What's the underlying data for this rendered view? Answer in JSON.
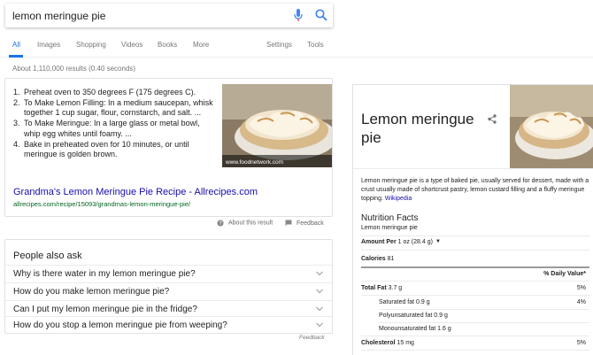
{
  "search": {
    "query": "lemon meringue pie",
    "mic_icon": "mic-icon",
    "search_icon": "search-icon",
    "colors": {
      "mic_blue": "#4285f4",
      "mic_red": "#ea4335",
      "search_blue": "#4285f4"
    }
  },
  "tabs": {
    "all": "All",
    "images": "Images",
    "shopping": "Shopping",
    "videos": "Videos",
    "books": "Books",
    "more": "More",
    "settings": "Settings",
    "tools": "Tools",
    "active": "All",
    "accent": "#1a73e8"
  },
  "result_stats": "About 1,110,000 results (0.40 seconds)",
  "snippet": {
    "steps": [
      {
        "num": "1.",
        "text": "Preheat oven to 350 degrees F (175 degrees C)."
      },
      {
        "num": "2.",
        "text": "To Make Lemon Filling: In a medium saucepan, whisk together 1 cup sugar, flour, cornstarch, and salt. ..."
      },
      {
        "num": "3.",
        "text": "To Make Meringue: In a large glass or metal bowl, whip egg whites until foamy. ..."
      },
      {
        "num": "4.",
        "text": "Bake in preheated oven for 10 minutes, or until meringue is golden brown."
      }
    ],
    "image_credit": "www.foodnetwork.com",
    "link_title": "Grandma's Lemon Meringue Pie Recipe - Allrecipes.com",
    "url": "allrecipes.com/recipe/15093/grandmas-lemon-meringue-pie/",
    "link_color": "#1a0dab",
    "url_color": "#006621"
  },
  "about_result": "About this result",
  "feedback": "Feedback",
  "people_also_ask": {
    "title": "People also ask",
    "questions": [
      "Why is there water in my lemon meringue pie?",
      "How do you make lemon meringue pie?",
      "Can I put my lemon meringue pie in the fridge?",
      "How do you stop a lemon meringue pie from weeping?"
    ],
    "feedback": "Feedback"
  },
  "knowledge_panel": {
    "title": "Lemon meringue pie",
    "share_icon": "share-icon",
    "description": "Lemon meringue pie is a type of baked pie, usually served for dessert, made with a crust usually made of shortcrust pastry, lemon custard filling and a fluffy meringue topping.",
    "source_link": "Wikipedia",
    "nutrition": {
      "title": "Nutrition Facts",
      "subtitle": "Lemon meringue pie",
      "amount_per_label": "Amount Per",
      "amount_per_value": "1 oz (28.4 g)",
      "calories_label": "Calories",
      "calories_value": "81",
      "daily_value_header": "% Daily Value*",
      "rows": [
        {
          "label": "Total Fat",
          "value": "3.7 g",
          "dv": "5%",
          "bold": true
        },
        {
          "label": "Saturated fat",
          "value": "0.9 g",
          "dv": "4%",
          "bold": false
        },
        {
          "label": "Polyunsaturated fat",
          "value": "0.9 g",
          "dv": "",
          "bold": false
        },
        {
          "label": "Monounsaturated fat",
          "value": "1.6 g",
          "dv": "",
          "bold": false
        },
        {
          "label": "Cholesterol",
          "value": "15 mg",
          "dv": "5%",
          "bold": true
        }
      ]
    }
  }
}
